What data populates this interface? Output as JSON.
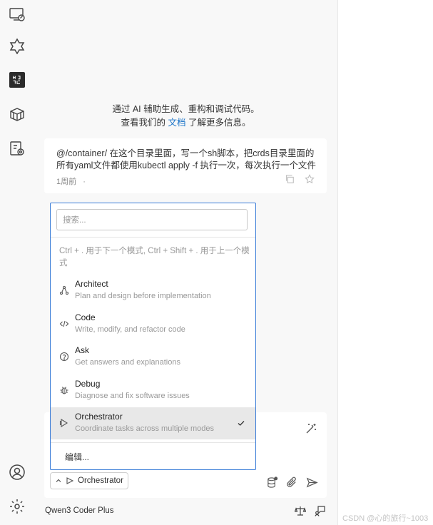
{
  "welcome": {
    "line1": "通过 AI 辅助生成、重构和调试代码。",
    "line2_prefix": "查看我们的 ",
    "line2_link": "文档",
    "line2_suffix": " 了解更多信息。"
  },
  "history": {
    "text": "@/container/ 在这个目录里面，写一个sh脚本，把crds目录里面的所有yaml文件都使用kubectl apply -f 执行一次，每次执行一个文件",
    "time": "1周前",
    "separator": "·"
  },
  "mode_dropdown": {
    "search_placeholder": "搜索...",
    "hint": "Ctrl + . 用于下一个模式, Ctrl + Shift + . 用于上一个模式",
    "modes": [
      {
        "title": "Architect",
        "desc": "Plan and design before implementation",
        "icon": "architect-icon"
      },
      {
        "title": "Code",
        "desc": "Write, modify, and refactor code",
        "icon": "code-icon"
      },
      {
        "title": "Ask",
        "desc": "Get answers and explanations",
        "icon": "question-circle-icon"
      },
      {
        "title": "Debug",
        "desc": "Diagnose and fix software issues",
        "icon": "bug-icon"
      },
      {
        "title": "Orchestrator",
        "desc": "Coordinate tasks across multiple modes",
        "icon": "orchestrator-icon",
        "selected": true
      }
    ],
    "edit_label": "编辑..."
  },
  "input": {
    "current_mode": "Orchestrator"
  },
  "bottom": {
    "model": "Qwen3 Coder Plus"
  },
  "watermark": "CSDN @心的旅行~1003",
  "colors": {
    "accent": "#1a73c8",
    "dropdown_border": "#3b7dd8",
    "selected_bg": "#e8e8e8"
  }
}
